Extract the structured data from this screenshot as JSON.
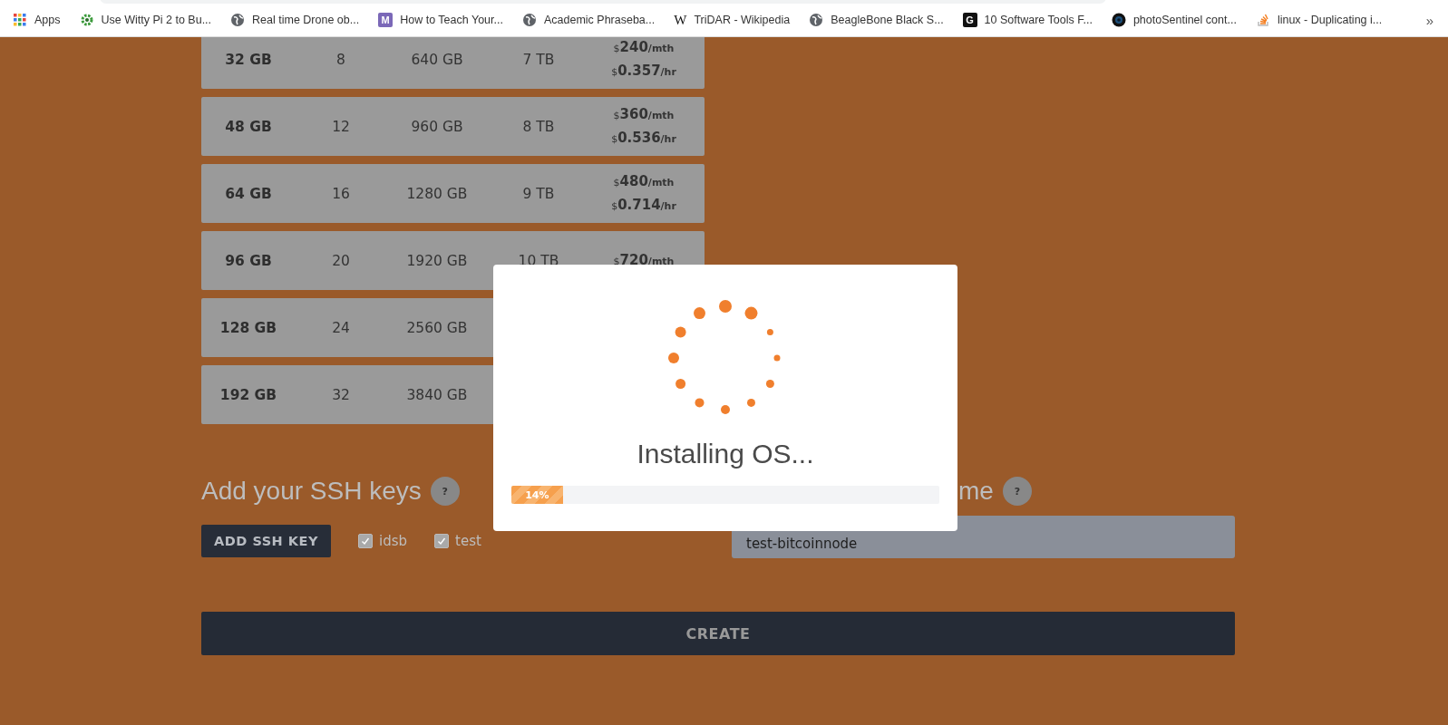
{
  "bookmarks": [
    {
      "label": "Apps",
      "kind": "apps"
    },
    {
      "label": "Use Witty Pi 2 to Bu...",
      "kind": "gear"
    },
    {
      "label": "Real time Drone ob...",
      "kind": "globe"
    },
    {
      "label": "How to Teach Your...",
      "kind": "monogram",
      "badge": "M"
    },
    {
      "label": "Academic Phraseba...",
      "kind": "globe"
    },
    {
      "label": "TriDAR - Wikipedia",
      "kind": "wiki",
      "badge": "W"
    },
    {
      "label": "BeagleBone Black S...",
      "kind": "globe"
    },
    {
      "label": "10 Software Tools F...",
      "kind": "square",
      "badge": "G"
    },
    {
      "label": "photoSentinel cont...",
      "kind": "lens"
    },
    {
      "label": "linux - Duplicating i...",
      "kind": "stack"
    }
  ],
  "bookmarks_more": "»",
  "plans": [
    {
      "ram": "32 GB",
      "cpu": "8",
      "storage": "640 GB",
      "transfer": "7 TB",
      "prices": [
        {
          "currency": "$",
          "amount": "240",
          "unit": "/mth"
        },
        {
          "currency": "$",
          "amount": "0.357",
          "unit": "/hr"
        }
      ]
    },
    {
      "ram": "48 GB",
      "cpu": "12",
      "storage": "960 GB",
      "transfer": "8 TB",
      "prices": [
        {
          "currency": "$",
          "amount": "360",
          "unit": "/mth"
        },
        {
          "currency": "$",
          "amount": "0.536",
          "unit": "/hr"
        }
      ]
    },
    {
      "ram": "64 GB",
      "cpu": "16",
      "storage": "1280 GB",
      "transfer": "9 TB",
      "prices": [
        {
          "currency": "$",
          "amount": "480",
          "unit": "/mth"
        },
        {
          "currency": "$",
          "amount": "0.714",
          "unit": "/hr"
        }
      ]
    },
    {
      "ram": "96 GB",
      "cpu": "20",
      "storage": "1920 GB",
      "transfer": "10 TB",
      "prices": [
        {
          "currency": "$",
          "amount": "720",
          "unit": "/mth"
        }
      ]
    },
    {
      "ram": "128 GB",
      "cpu": "24",
      "storage": "2560 GB"
    },
    {
      "ram": "192 GB",
      "cpu": "32",
      "storage": "3840 GB"
    }
  ],
  "ssh": {
    "heading": "Add your SSH keys",
    "help": "?",
    "add_button": "ADD SSH KEY",
    "keys": [
      {
        "label": "idsb",
        "checked": true
      },
      {
        "label": "test",
        "checked": true
      }
    ]
  },
  "hostname": {
    "heading": "me",
    "help": "?",
    "value": "test-bitcoinnode"
  },
  "create_button": "CREATE",
  "modal": {
    "title": "Installing OS...",
    "progress": {
      "level": 0.12,
      "label": "14%"
    }
  }
}
